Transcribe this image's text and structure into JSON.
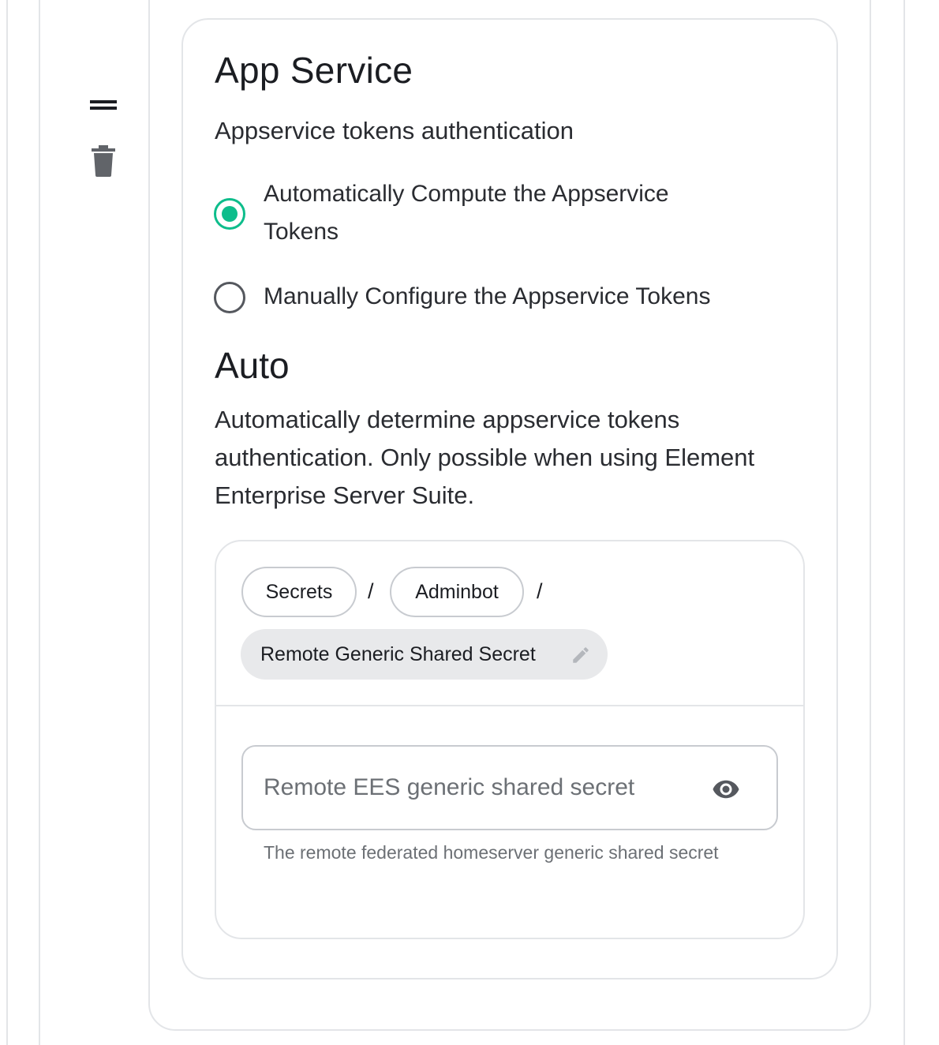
{
  "section": {
    "title": "App Service",
    "subtitle": "Appservice tokens authentication"
  },
  "radio_options": [
    {
      "label_line1": "Automatically Compute the Appservice",
      "label_line2": "Tokens",
      "selected": true
    },
    {
      "label": "Manually Configure the Appservice Tokens",
      "selected": false
    }
  ],
  "auto": {
    "title": "Auto",
    "description": "Automatically determine appservice tokens authentication. Only possible when using Element Enterprise Server Suite."
  },
  "secret_path": {
    "crumbs": [
      "Secrets",
      "Adminbot"
    ],
    "separator": "/",
    "current": "Remote Generic Shared Secret"
  },
  "secret_field": {
    "placeholder": "Remote EES generic shared secret",
    "value": "",
    "helper": "The remote federated homeserver generic shared secret"
  },
  "icons": {
    "drag": "drag-handle-icon",
    "delete": "trash-icon",
    "edit": "pencil-icon",
    "reveal": "eye-icon"
  },
  "colors": {
    "accent": "#0dbd8b",
    "border": "#e3e5e8",
    "text": "#1b1d22",
    "muted": "#6c7075",
    "chip_fill": "#e8e9eb"
  }
}
